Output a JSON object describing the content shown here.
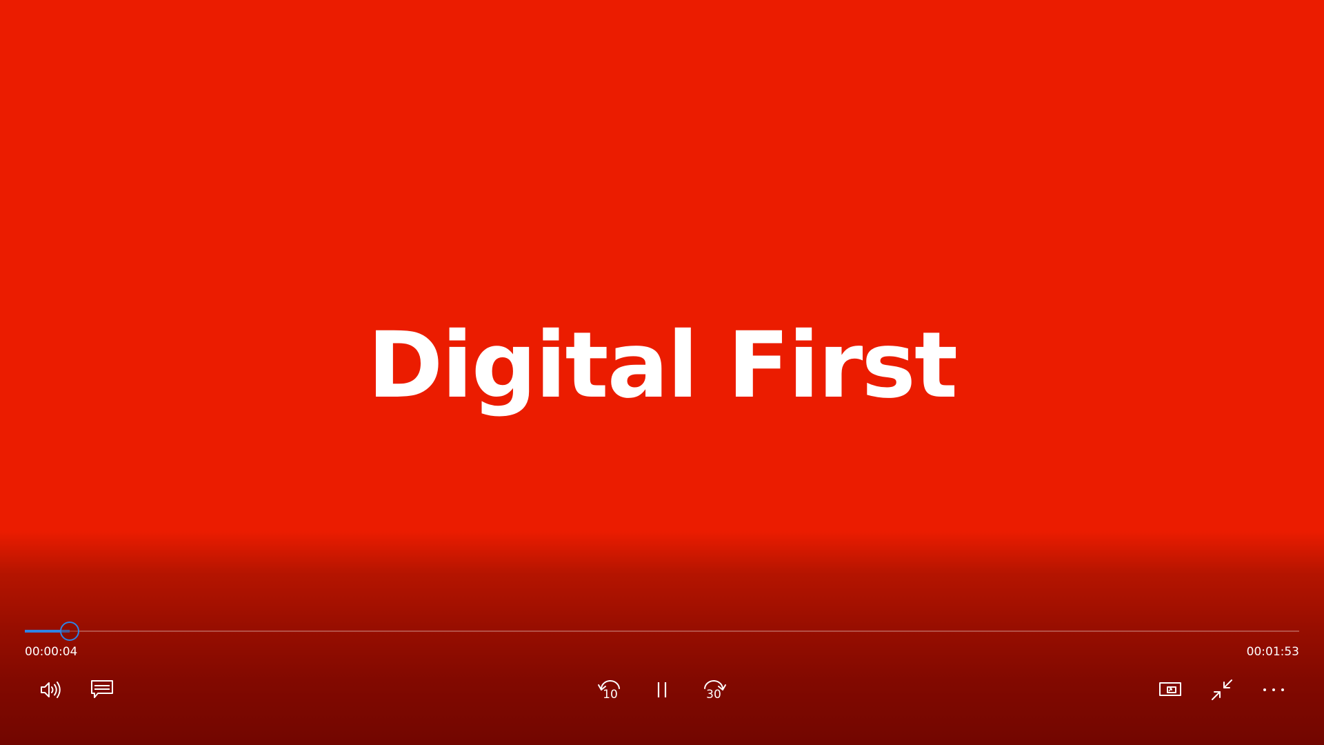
{
  "video": {
    "title": "Digital First",
    "background_color": "#EB1C00"
  },
  "playback": {
    "elapsed": "00:00:04",
    "total": "00:01:53",
    "progress_fraction": 0.035,
    "accent_color": "#2E83E6"
  },
  "controls": {
    "left": [
      {
        "name": "volume-button",
        "icon": "speaker-icon"
      },
      {
        "name": "captions-button",
        "icon": "captions-icon"
      }
    ],
    "center": [
      {
        "name": "skip-back-button",
        "icon": "rewind-10-icon",
        "label": "10"
      },
      {
        "name": "pause-button",
        "icon": "pause-icon"
      },
      {
        "name": "skip-forward-button",
        "icon": "forward-30-icon",
        "label": "30"
      }
    ],
    "right": [
      {
        "name": "mini-view-button",
        "icon": "mini-player-icon"
      },
      {
        "name": "exit-fullscreen-button",
        "icon": "exit-fullscreen-icon"
      },
      {
        "name": "more-options-button",
        "icon": "more-dots-icon"
      }
    ]
  }
}
